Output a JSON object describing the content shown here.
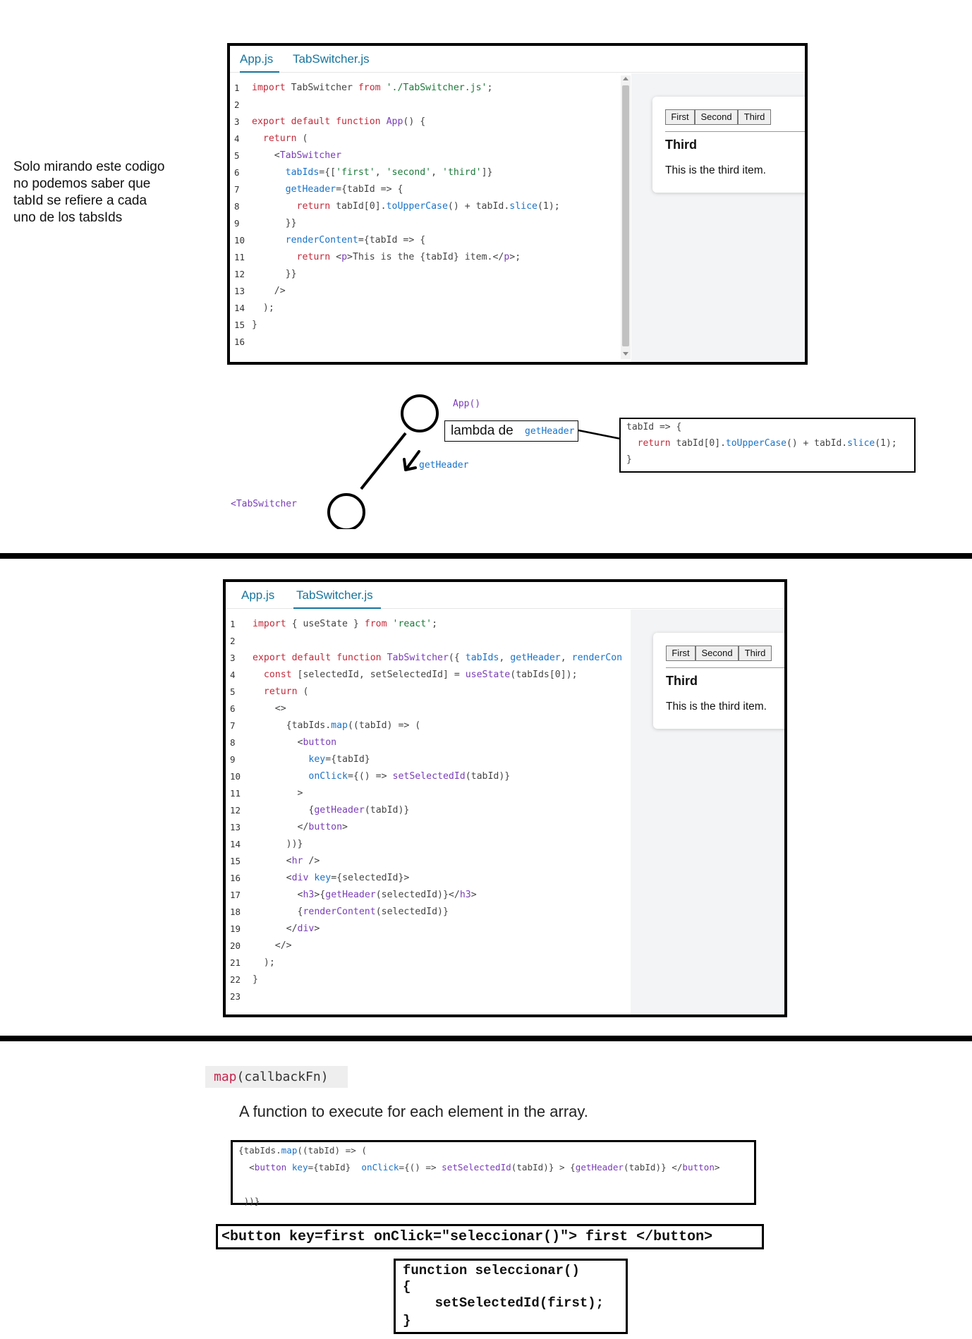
{
  "note": {
    "lines": [
      "Solo mirando este codigo",
      "no podemos saber que",
      "tabId se refiere a cada",
      "uno de los tabsIds"
    ]
  },
  "sandbox1": {
    "tabs": [
      "App.js",
      "TabSwitcher.js"
    ],
    "active_tab": "App.js",
    "line_numbers": [
      "1",
      "2",
      "3",
      "4",
      "5",
      "6",
      "7",
      "8",
      "9",
      "10",
      "11",
      "12",
      "13",
      "14",
      "15",
      "16"
    ],
    "code": [
      [
        [
          "kw",
          "import"
        ],
        [
          "pl",
          " TabSwitcher "
        ],
        [
          "kw",
          "from"
        ],
        [
          "pl",
          " "
        ],
        [
          "str",
          "'./TabSwitcher.js'"
        ],
        [
          "pl",
          ";"
        ]
      ],
      [],
      [
        [
          "kw",
          "export default function"
        ],
        [
          "pl",
          " "
        ],
        [
          "fn",
          "App"
        ],
        [
          "pl",
          "() {"
        ]
      ],
      [
        [
          "pl",
          "  "
        ],
        [
          "kw",
          "return"
        ],
        [
          "pl",
          " ("
        ]
      ],
      [
        [
          "pl",
          "    <"
        ],
        [
          "tag",
          "TabSwitcher"
        ]
      ],
      [
        [
          "pl",
          "      "
        ],
        [
          "attr",
          "tabIds"
        ],
        [
          "pl",
          "={["
        ],
        [
          "str",
          "'first'"
        ],
        [
          "pl",
          ", "
        ],
        [
          "str",
          "'second'"
        ],
        [
          "pl",
          ", "
        ],
        [
          "str",
          "'third'"
        ],
        [
          "pl",
          "]}"
        ]
      ],
      [
        [
          "pl",
          "      "
        ],
        [
          "attr",
          "getHeader"
        ],
        [
          "pl",
          "={tabId => {"
        ]
      ],
      [
        [
          "pl",
          "        "
        ],
        [
          "kw",
          "return"
        ],
        [
          "pl",
          " tabId[0]."
        ],
        [
          "prop",
          "toUpperCase"
        ],
        [
          "pl",
          "() + tabId."
        ],
        [
          "prop",
          "slice"
        ],
        [
          "pl",
          "(1);"
        ]
      ],
      [
        [
          "pl",
          "      }}"
        ]
      ],
      [
        [
          "pl",
          "      "
        ],
        [
          "attr",
          "renderContent"
        ],
        [
          "pl",
          "={tabId => {"
        ]
      ],
      [
        [
          "pl",
          "        "
        ],
        [
          "kw",
          "return"
        ],
        [
          "pl",
          " <"
        ],
        [
          "tag",
          "p"
        ],
        [
          "pl",
          ">This is the {tabId} item.</"
        ],
        [
          "tag",
          "p"
        ],
        [
          "pl",
          ">;"
        ]
      ],
      [
        [
          "pl",
          "      }}"
        ]
      ],
      [
        [
          "pl",
          "    />"
        ]
      ],
      [
        [
          "pl",
          "  );"
        ]
      ],
      [
        [
          "pl",
          "}"
        ]
      ],
      []
    ],
    "preview": {
      "buttons": [
        "First",
        "Second",
        "Third"
      ],
      "heading": "Third",
      "text": "This is the third item."
    }
  },
  "diagram": {
    "app_label": "App()",
    "lambda_label": "lambda de",
    "lambda_fn": "getHeader",
    "arrow_label": "getHeader",
    "tabswitcher_label": "<TabSwitcher",
    "lambda_code": [
      [
        [
          "pl",
          "tabId => {"
        ]
      ],
      [
        [
          "pl",
          "  "
        ],
        [
          "kw",
          "return"
        ],
        [
          "pl",
          " tabId[0]."
        ],
        [
          "prop",
          "toUpperCase"
        ],
        [
          "pl",
          "() + tabId."
        ],
        [
          "prop",
          "slice"
        ],
        [
          "pl",
          "(1);"
        ]
      ],
      [
        [
          "pl",
          "}"
        ]
      ]
    ]
  },
  "sandbox2": {
    "tabs": [
      "App.js",
      "TabSwitcher.js"
    ],
    "active_tab": "TabSwitcher.js",
    "line_numbers": [
      "1",
      "2",
      "3",
      "4",
      "5",
      "6",
      "7",
      "8",
      "9",
      "10",
      "11",
      "12",
      "13",
      "14",
      "15",
      "16",
      "17",
      "18",
      "19",
      "20",
      "21",
      "22",
      "23"
    ],
    "code": [
      [
        [
          "kw",
          "import"
        ],
        [
          "pl",
          " { useState } "
        ],
        [
          "kw",
          "from"
        ],
        [
          "pl",
          " "
        ],
        [
          "str",
          "'react'"
        ],
        [
          "pl",
          ";"
        ]
      ],
      [],
      [
        [
          "kw",
          "export default function"
        ],
        [
          "pl",
          " "
        ],
        [
          "fn",
          "TabSwitcher"
        ],
        [
          "pl",
          "({ "
        ],
        [
          "attr",
          "tabIds"
        ],
        [
          "pl",
          ", "
        ],
        [
          "attr",
          "getHeader"
        ],
        [
          "pl",
          ", "
        ],
        [
          "attr",
          "renderCon"
        ]
      ],
      [
        [
          "pl",
          "  "
        ],
        [
          "kw",
          "const"
        ],
        [
          "pl",
          " [selectedId, setSelectedId] = "
        ],
        [
          "fn",
          "useState"
        ],
        [
          "pl",
          "(tabIds[0]);"
        ]
      ],
      [
        [
          "pl",
          "  "
        ],
        [
          "kw",
          "return"
        ],
        [
          "pl",
          " ("
        ]
      ],
      [
        [
          "pl",
          "    <>"
        ]
      ],
      [
        [
          "pl",
          "      {tabIds."
        ],
        [
          "prop",
          "map"
        ],
        [
          "pl",
          "((tabId) => ("
        ]
      ],
      [
        [
          "pl",
          "        <"
        ],
        [
          "tag",
          "button"
        ]
      ],
      [
        [
          "pl",
          "          "
        ],
        [
          "attr",
          "key"
        ],
        [
          "pl",
          "={tabId}"
        ]
      ],
      [
        [
          "pl",
          "          "
        ],
        [
          "attr",
          "onClick"
        ],
        [
          "pl",
          "={() => "
        ],
        [
          "fn",
          "setSelectedId"
        ],
        [
          "pl",
          "(tabId)}"
        ]
      ],
      [
        [
          "pl",
          "        >"
        ]
      ],
      [
        [
          "pl",
          "          {"
        ],
        [
          "fn",
          "getHeader"
        ],
        [
          "pl",
          "(tabId)}"
        ]
      ],
      [
        [
          "pl",
          "        </"
        ],
        [
          "tag",
          "button"
        ],
        [
          "pl",
          ">"
        ]
      ],
      [
        [
          "pl",
          "      ))}"
        ]
      ],
      [
        [
          "pl",
          "      <"
        ],
        [
          "tag",
          "hr"
        ],
        [
          "pl",
          " />"
        ]
      ],
      [
        [
          "pl",
          "      <"
        ],
        [
          "tag",
          "div"
        ],
        [
          "pl",
          " "
        ],
        [
          "attr",
          "key"
        ],
        [
          "pl",
          "={selectedId}>"
        ]
      ],
      [
        [
          "pl",
          "        <"
        ],
        [
          "tag",
          "h3"
        ],
        [
          "pl",
          ">{"
        ],
        [
          "fn",
          "getHeader"
        ],
        [
          "pl",
          "(selectedId)}</"
        ],
        [
          "tag",
          "h3"
        ],
        [
          "pl",
          ">"
        ]
      ],
      [
        [
          "pl",
          "        {"
        ],
        [
          "fn",
          "renderContent"
        ],
        [
          "pl",
          "(selectedId)}"
        ]
      ],
      [
        [
          "pl",
          "      </"
        ],
        [
          "tag",
          "div"
        ],
        [
          "pl",
          ">"
        ]
      ],
      [
        [
          "pl",
          "    </>"
        ]
      ],
      [
        [
          "pl",
          "  );"
        ]
      ],
      [
        [
          "pl",
          "}"
        ]
      ],
      []
    ],
    "preview": {
      "buttons": [
        "First",
        "Second",
        "Third"
      ],
      "heading": "Third",
      "text": "This is the third item."
    }
  },
  "mdn": {
    "signature_fn": "map",
    "signature_args": "(callbackFn)",
    "description": "A function to execute for each element in the array."
  },
  "snippet": {
    "lines": [
      [
        [
          "pl",
          "{tabIds."
        ],
        [
          "prop",
          "map"
        ],
        [
          "pl",
          "((tabId) => ("
        ]
      ],
      [
        [
          "pl",
          "  <"
        ],
        [
          "tag",
          "button"
        ],
        [
          "pl",
          " "
        ],
        [
          "attr",
          "key"
        ],
        [
          "pl",
          "={tabId}  "
        ],
        [
          "attr",
          "onClick"
        ],
        [
          "pl",
          "={() => "
        ],
        [
          "fn",
          "setSelectedId"
        ],
        [
          "pl",
          "(tabId)} > {"
        ],
        [
          "fn",
          "getHeader"
        ],
        [
          "pl",
          "(tabId)} </"
        ],
        [
          "tag",
          "button"
        ],
        [
          "pl",
          ">"
        ]
      ],
      [],
      [
        [
          "pl",
          " ))}"
        ]
      ]
    ]
  },
  "button_example": "<button key=first onClick=\"seleccionar()\"> first </button>",
  "function_example": [
    "function seleccionar()",
    "{",
    "    setSelectedId(first);",
    "}"
  ]
}
